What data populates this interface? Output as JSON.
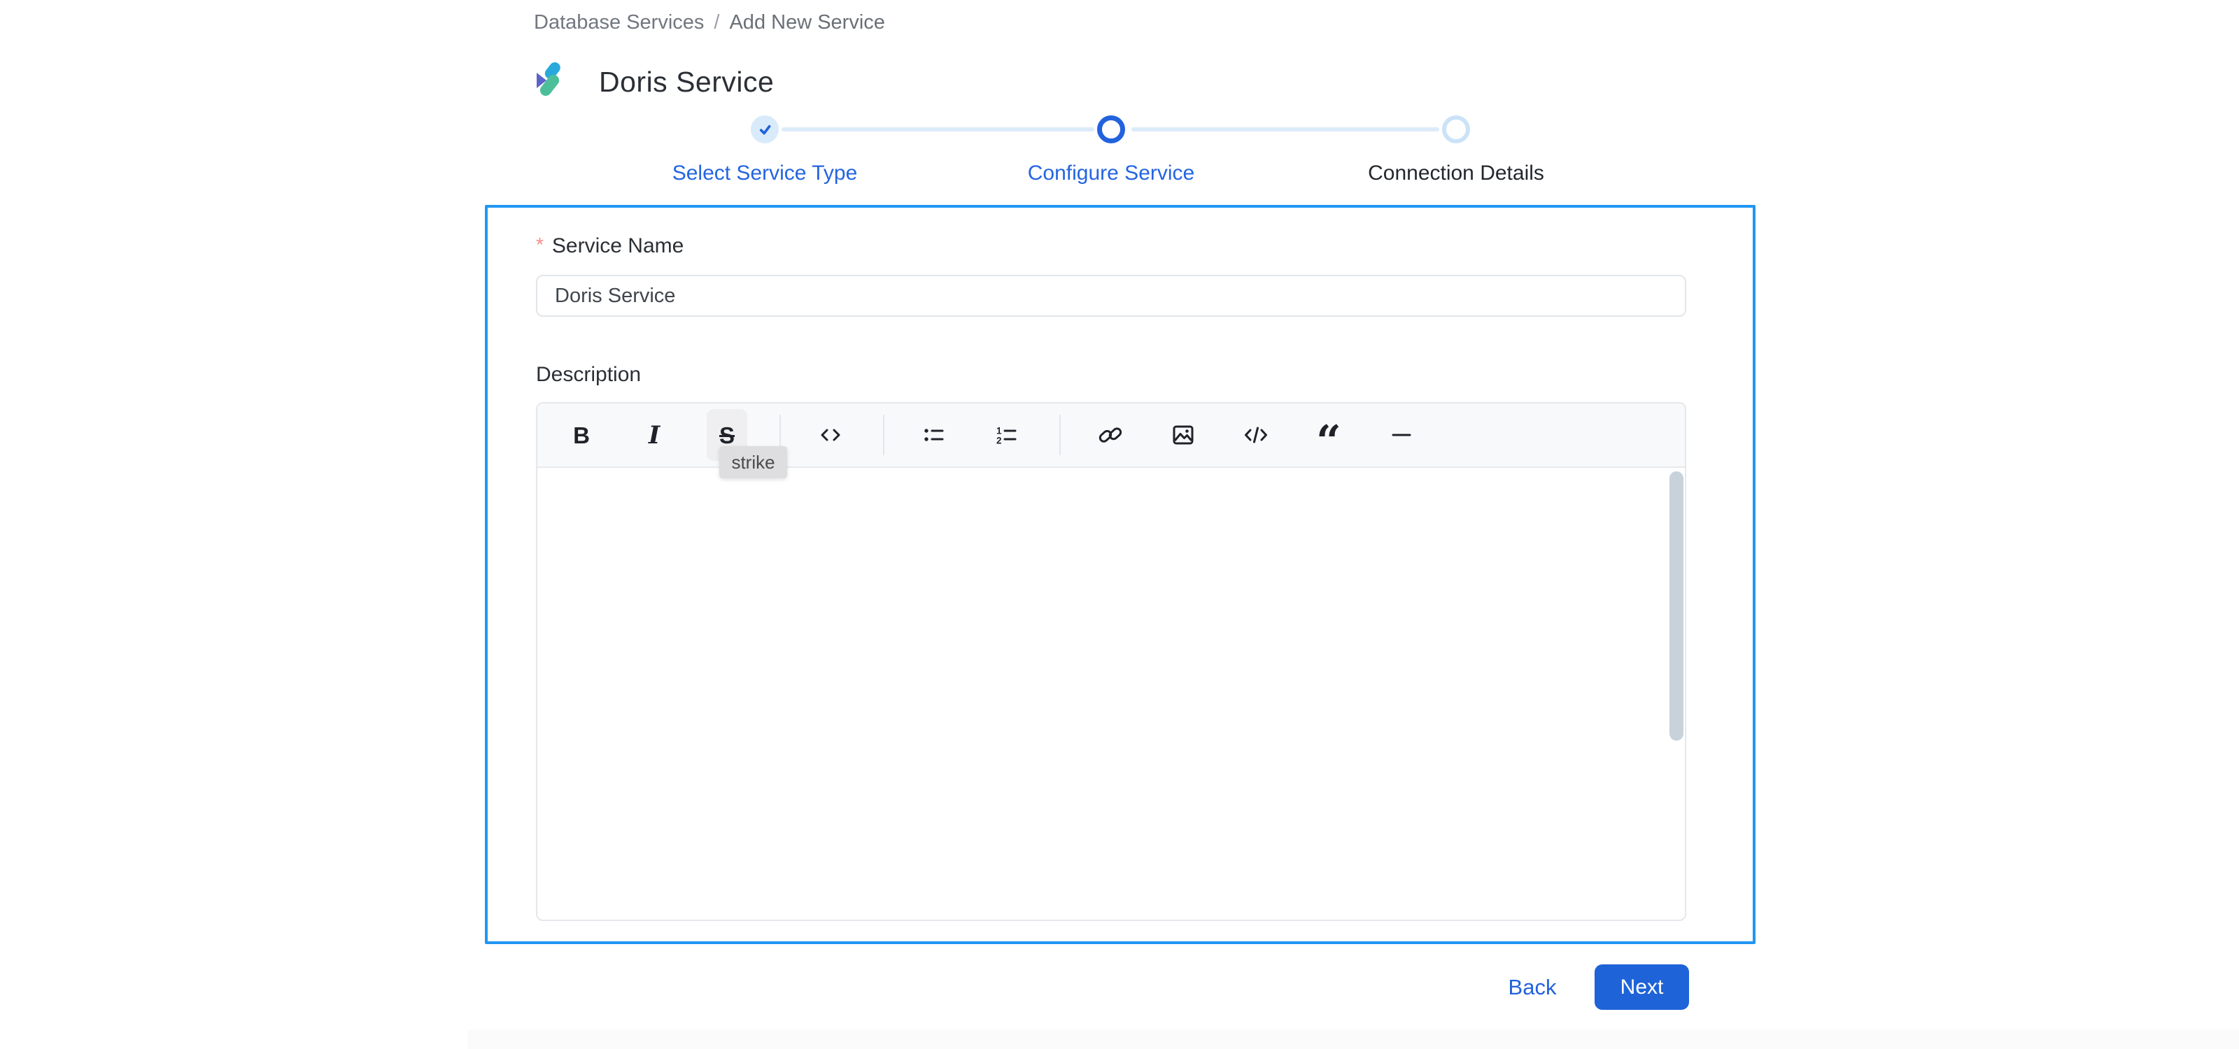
{
  "colors": {
    "accent_blue": "#2262DD",
    "card_border_blue": "#2196F3",
    "next_button_bg": "#1E63D7",
    "step_done_fill": "#D9EAFA",
    "step_pending_ring": "#CBE3F8",
    "step_connector": "#DCEBFA",
    "required_red": "#F28B8B",
    "toolbar_bg": "#F8F9FB",
    "tooltip_bg": "#DEDEE0",
    "logo_purple": "#5B62C9",
    "logo_blue": "#28A9DB",
    "logo_teal": "#4CBF9A"
  },
  "breadcrumb": {
    "items": [
      {
        "label": "Database Services"
      },
      {
        "label": "Add New Service"
      }
    ],
    "separator": "/"
  },
  "header": {
    "title": "Doris Service",
    "logo": "doris-logo"
  },
  "stepper": {
    "steps": [
      {
        "label": "Select Service Type",
        "state": "completed",
        "icon": "check-icon"
      },
      {
        "label": "Configure Service",
        "state": "active"
      },
      {
        "label": "Connection Details",
        "state": "pending"
      }
    ]
  },
  "form": {
    "service_name": {
      "label": "Service Name",
      "required_mark": "*",
      "value": "Doris Service"
    },
    "description": {
      "label": "Description",
      "value": ""
    }
  },
  "editor": {
    "toolbar": {
      "groups": [
        [
          "bold",
          "italic",
          "strike"
        ],
        [
          "code"
        ],
        [
          "bullet-list",
          "ordered-list"
        ],
        [
          "link",
          "image",
          "code-block",
          "blockquote",
          "horizontal-rule"
        ]
      ],
      "glyphs": {
        "bold": "B",
        "italic": "I",
        "strike": "S",
        "blockquote": "“"
      },
      "hovered_button": "strike"
    },
    "tooltip": {
      "text": "strike"
    },
    "content": ""
  },
  "actions": {
    "back_label": "Back",
    "next_label": "Next"
  }
}
